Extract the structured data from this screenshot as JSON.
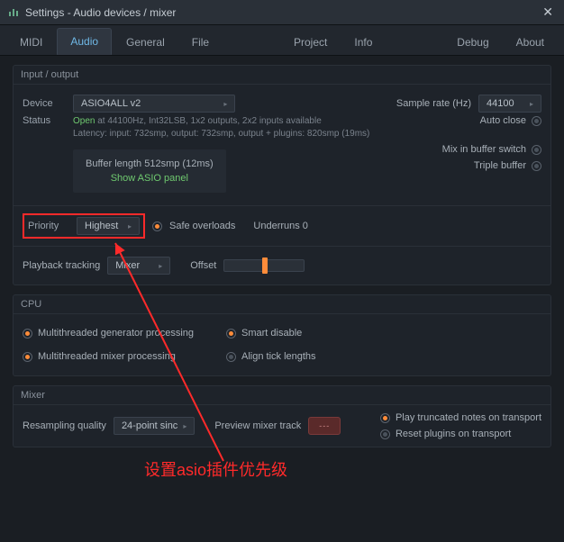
{
  "window": {
    "title": "Settings - Audio devices / mixer"
  },
  "tabs": [
    "MIDI",
    "Audio",
    "General",
    "File",
    "Project",
    "Info",
    "Debug",
    "About"
  ],
  "active_tab": "Audio",
  "io": {
    "header": "Input / output",
    "device_label": "Device",
    "device_value": "ASIO4ALL v2",
    "sample_rate_label": "Sample rate (Hz)",
    "sample_rate_value": "44100",
    "status_label": "Status",
    "status_open": "Open",
    "status_line1": "at 44100Hz, Int32LSB, 1x2 outputs, 2x2 inputs available",
    "status_line2": "Latency: input: 732smp, output: 732smp, output + plugins: 820smp (19ms)",
    "auto_close": "Auto close",
    "buffer_line": "Buffer length 512smp (12ms)",
    "show_asio": "Show ASIO panel",
    "mix_in_buffer": "Mix in buffer switch",
    "triple_buffer": "Triple buffer",
    "priority_label": "Priority",
    "priority_value": "Highest",
    "safe_overloads": "Safe overloads",
    "underruns": "Underruns 0",
    "playback_tracking_label": "Playback tracking",
    "playback_tracking_value": "Mixer",
    "offset_label": "Offset"
  },
  "cpu": {
    "header": "CPU",
    "multi_gen": "Multithreaded generator processing",
    "multi_mix": "Multithreaded mixer processing",
    "smart_disable": "Smart disable",
    "align_tick": "Align tick lengths"
  },
  "mixer": {
    "header": "Mixer",
    "resampling_label": "Resampling quality",
    "resampling_value": "24-point sinc",
    "preview_label": "Preview mixer track",
    "play_truncated": "Play truncated notes on transport",
    "reset_plugins": "Reset plugins on transport"
  },
  "annotation": "设置asio插件优先级"
}
